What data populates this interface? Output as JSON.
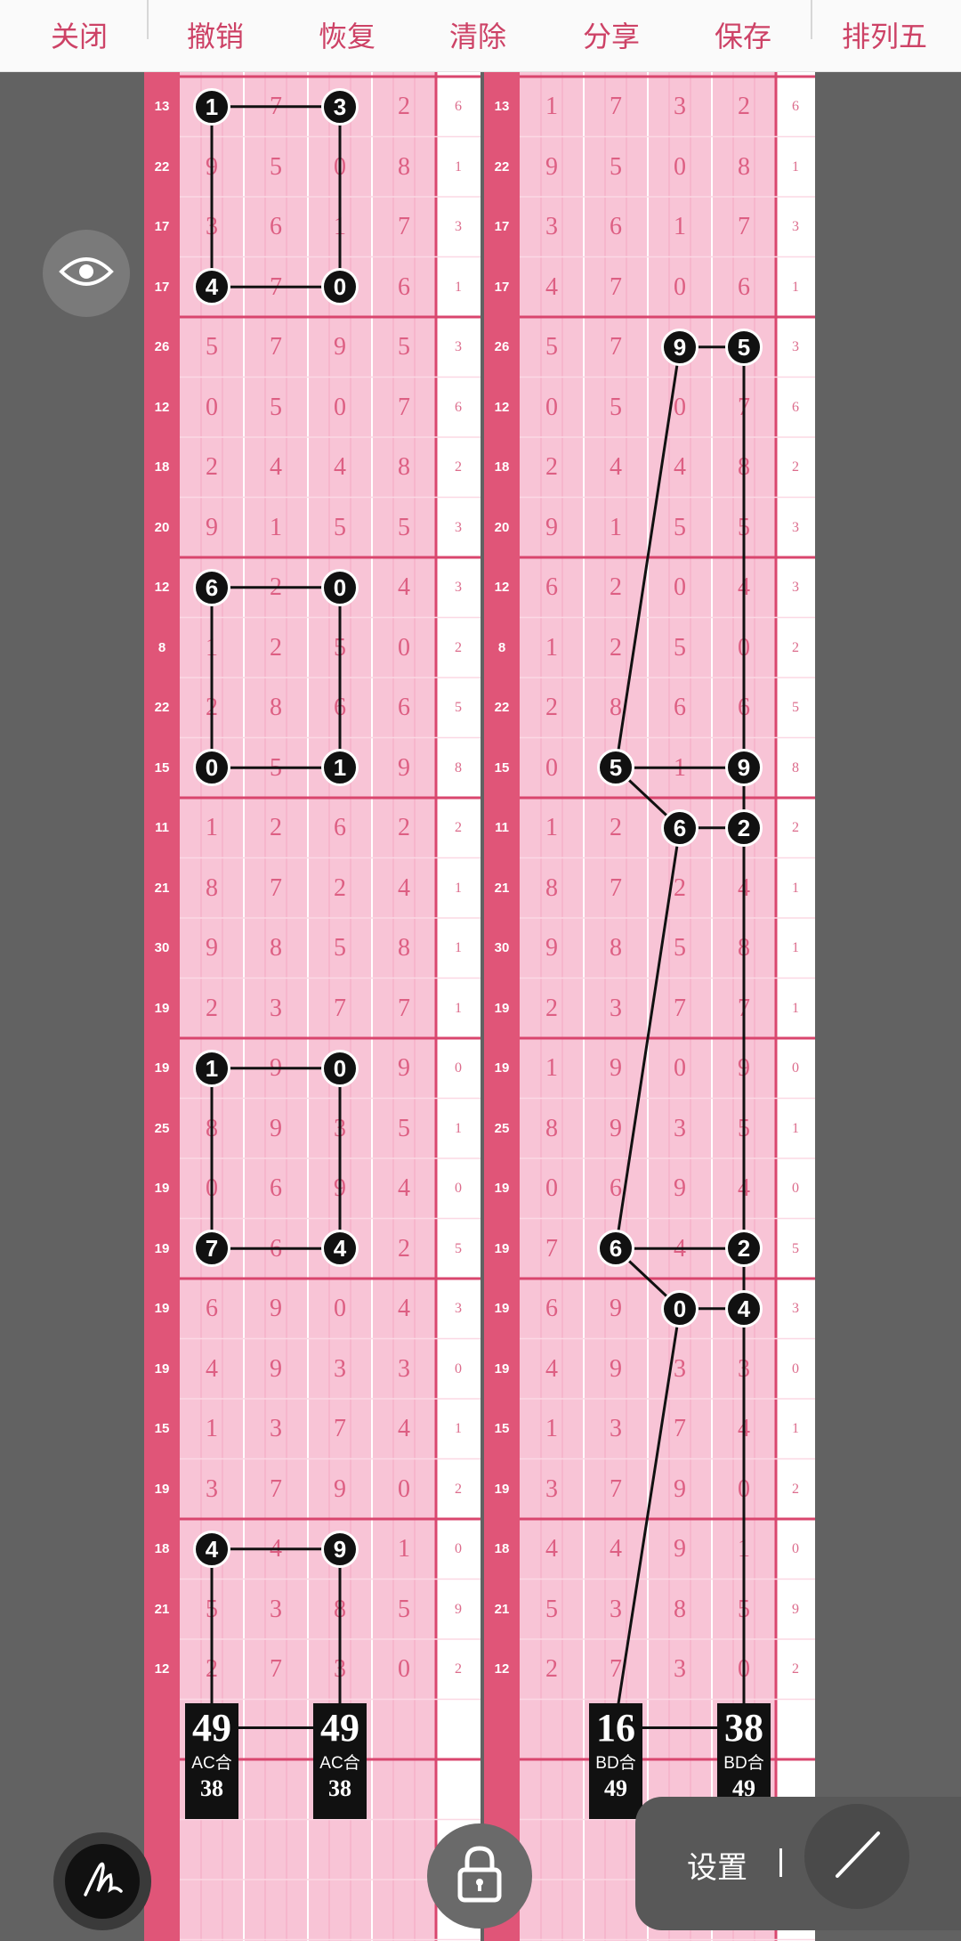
{
  "toolbar": {
    "items": [
      {
        "label": "关闭",
        "icon": "close-icon"
      },
      {
        "label": "撤销",
        "icon": "undo-icon"
      },
      {
        "label": "恢复",
        "icon": "redo-icon"
      },
      {
        "label": "清除",
        "icon": "trash-icon"
      },
      {
        "label": "分享",
        "icon": "share-icon"
      },
      {
        "label": "保存",
        "icon": "save-icon"
      },
      {
        "label": "排列五",
        "icon": "chart-icon"
      }
    ]
  },
  "rows": [
    {
      "sum": "13",
      "d": [
        "1",
        "7",
        "3",
        "2"
      ],
      "e": "6"
    },
    {
      "sum": "22",
      "d": [
        "9",
        "5",
        "0",
        "8"
      ],
      "e": "1"
    },
    {
      "sum": "17",
      "d": [
        "3",
        "6",
        "1",
        "7"
      ],
      "e": "3"
    },
    {
      "sum": "17",
      "d": [
        "4",
        "7",
        "0",
        "6"
      ],
      "e": "1"
    },
    {
      "sum": "26",
      "d": [
        "5",
        "7",
        "9",
        "5"
      ],
      "e": "3"
    },
    {
      "sum": "12",
      "d": [
        "0",
        "5",
        "0",
        "7"
      ],
      "e": "6"
    },
    {
      "sum": "18",
      "d": [
        "2",
        "4",
        "4",
        "8"
      ],
      "e": "2"
    },
    {
      "sum": "20",
      "d": [
        "9",
        "1",
        "5",
        "5"
      ],
      "e": "3"
    },
    {
      "sum": "12",
      "d": [
        "6",
        "2",
        "0",
        "4"
      ],
      "e": "3"
    },
    {
      "sum": "8",
      "d": [
        "1",
        "2",
        "5",
        "0"
      ],
      "e": "2"
    },
    {
      "sum": "22",
      "d": [
        "2",
        "8",
        "6",
        "6"
      ],
      "e": "5"
    },
    {
      "sum": "15",
      "d": [
        "0",
        "5",
        "1",
        "9"
      ],
      "e": "8"
    },
    {
      "sum": "11",
      "d": [
        "1",
        "2",
        "6",
        "2"
      ],
      "e": "2"
    },
    {
      "sum": "21",
      "d": [
        "8",
        "7",
        "2",
        "4"
      ],
      "e": "1"
    },
    {
      "sum": "30",
      "d": [
        "9",
        "8",
        "5",
        "8"
      ],
      "e": "1"
    },
    {
      "sum": "19",
      "d": [
        "2",
        "3",
        "7",
        "7"
      ],
      "e": "1"
    },
    {
      "sum": "19",
      "d": [
        "1",
        "9",
        "0",
        "9"
      ],
      "e": "0"
    },
    {
      "sum": "25",
      "d": [
        "8",
        "9",
        "3",
        "5"
      ],
      "e": "1"
    },
    {
      "sum": "19",
      "d": [
        "0",
        "6",
        "9",
        "4"
      ],
      "e": "0"
    },
    {
      "sum": "19",
      "d": [
        "7",
        "6",
        "4",
        "2"
      ],
      "e": "5"
    },
    {
      "sum": "19",
      "d": [
        "6",
        "9",
        "0",
        "4"
      ],
      "e": "3"
    },
    {
      "sum": "19",
      "d": [
        "4",
        "9",
        "3",
        "3"
      ],
      "e": "0"
    },
    {
      "sum": "15",
      "d": [
        "1",
        "3",
        "7",
        "4"
      ],
      "e": "1"
    },
    {
      "sum": "19",
      "d": [
        "3",
        "7",
        "9",
        "0"
      ],
      "e": "2"
    },
    {
      "sum": "18",
      "d": [
        "4",
        "4",
        "9",
        "1"
      ],
      "e": "0"
    },
    {
      "sum": "21",
      "d": [
        "5",
        "3",
        "8",
        "5"
      ],
      "e": "9"
    },
    {
      "sum": "12",
      "d": [
        "2",
        "7",
        "3",
        "0"
      ],
      "e": "2"
    }
  ],
  "left_marks": [
    {
      "row": 0,
      "col": 0
    },
    {
      "row": 0,
      "col": 2
    },
    {
      "row": 3,
      "col": 0
    },
    {
      "row": 3,
      "col": 2
    },
    {
      "row": 8,
      "col": 0
    },
    {
      "row": 8,
      "col": 2
    },
    {
      "row": 11,
      "col": 0
    },
    {
      "row": 11,
      "col": 2
    },
    {
      "row": 16,
      "col": 0
    },
    {
      "row": 16,
      "col": 2
    },
    {
      "row": 19,
      "col": 0
    },
    {
      "row": 19,
      "col": 2
    },
    {
      "row": 24,
      "col": 0
    },
    {
      "row": 24,
      "col": 2
    }
  ],
  "right_marks": [
    {
      "row": 4,
      "col": 2
    },
    {
      "row": 4,
      "col": 3
    },
    {
      "row": 11,
      "col": 1
    },
    {
      "row": 11,
      "col": 3
    },
    {
      "row": 12,
      "col": 2
    },
    {
      "row": 12,
      "col": 3
    },
    {
      "row": 19,
      "col": 1
    },
    {
      "row": 19,
      "col": 3
    },
    {
      "row": 20,
      "col": 2
    },
    {
      "row": 20,
      "col": 3
    }
  ],
  "totals": {
    "left": [
      {
        "big": "49",
        "label": "AC合",
        "small": "38"
      },
      {
        "big": "49",
        "label": "AC合",
        "small": "38"
      }
    ],
    "right": [
      {
        "big": "16",
        "label": "BD合",
        "small": "49"
      },
      {
        "big": "38",
        "label": "BD合",
        "small": "49"
      }
    ]
  },
  "bottom": {
    "settings_label": "设置"
  },
  "colors": {
    "accent": "#cd4266",
    "pink_cell": "#f8c4d6",
    "strip": "#e05578",
    "grid_major": "#d9466e",
    "background": "#626262"
  }
}
